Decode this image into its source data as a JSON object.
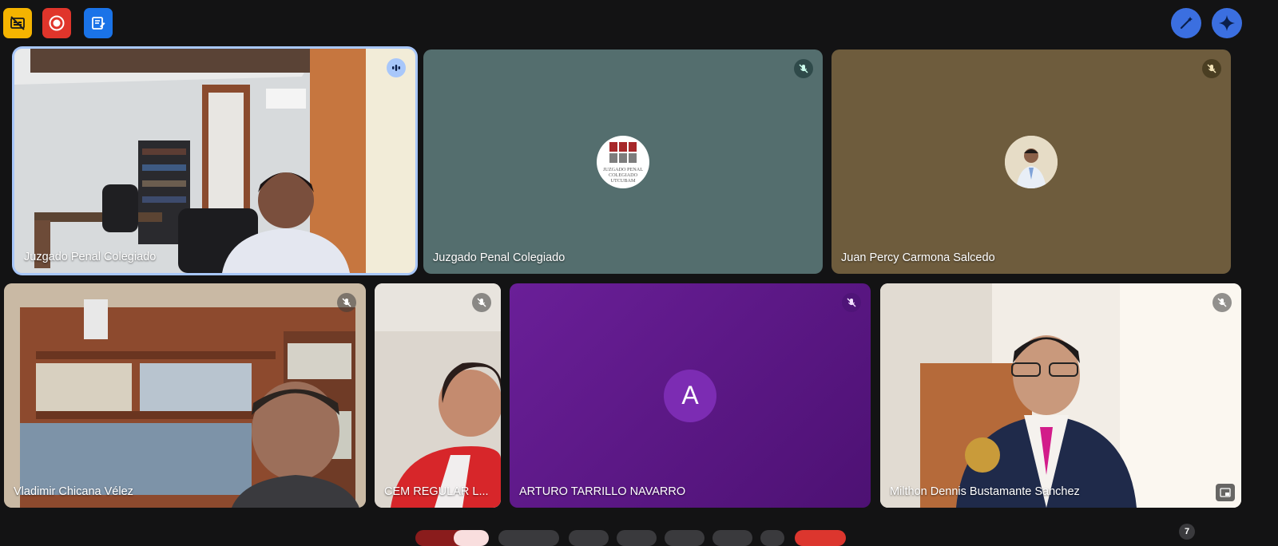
{
  "toolbar": {
    "left": [
      {
        "icon": "captions-off-icon",
        "color": "#f5b400"
      },
      {
        "icon": "record-icon",
        "color": "#e0352b"
      },
      {
        "icon": "notes-icon",
        "color": "#1a73e8"
      }
    ],
    "right": [
      {
        "icon": "magic-wand-icon"
      },
      {
        "icon": "sparkle-icon"
      }
    ]
  },
  "tiles": [
    {
      "name": "Juzgado Penal Colegiado",
      "type": "video",
      "speaking": true
    },
    {
      "name": "Juzgado Penal Colegiado",
      "type": "avatar",
      "muted": true,
      "bg": "#546e6e",
      "logo_text": [
        "JUZGADO PENAL",
        "COLEGIADO",
        "UTCUBAM"
      ]
    },
    {
      "name": "Juan Percy Carmona Salcedo",
      "type": "avatar",
      "muted": true,
      "bg": "#6e5c3d"
    },
    {
      "name": "Vladimir Chicana Vélez",
      "type": "video",
      "muted": true
    },
    {
      "name": "CEM REGULAR L...",
      "type": "video",
      "muted": true
    },
    {
      "name": "ARTURO TARRILLO NAVARRO",
      "type": "avatar",
      "muted": true,
      "bg": "#5f1a8c",
      "initial": "A"
    },
    {
      "name": "Milthon Dennis Bustamante Sanchez",
      "type": "video",
      "muted": true
    }
  ],
  "participant_count": "7"
}
